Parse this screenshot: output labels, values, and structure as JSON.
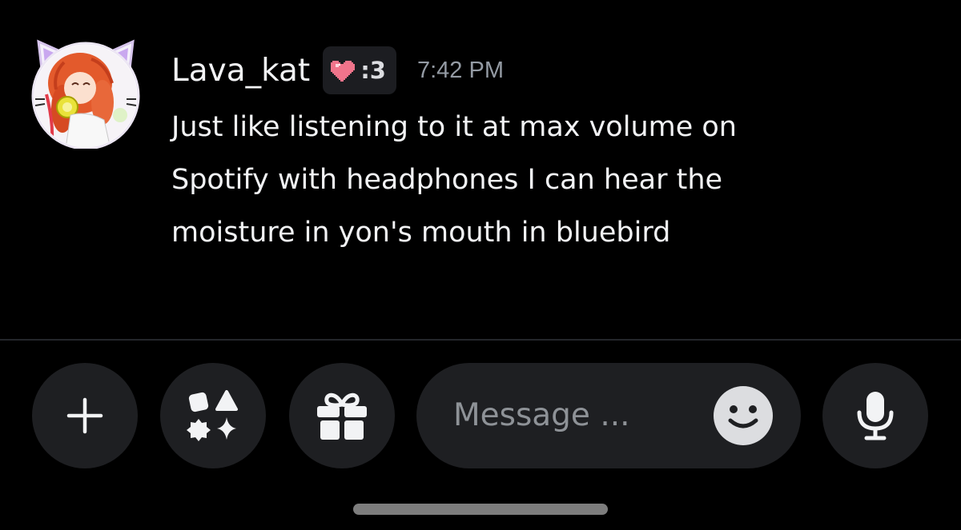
{
  "message": {
    "author": {
      "username": "Lava_kat",
      "clan_tag": ":3",
      "clan_icon": "pixel-heart-icon",
      "avatar": "anime-cat-girl-avatar"
    },
    "timestamp": "7:42 PM",
    "lines": [
      "Just like listening to it at max volume on",
      "Spotify with headphones I can hear the",
      "moisture in yon's mouth in bluebird"
    ]
  },
  "composer": {
    "buttons": {
      "add": "plus-icon",
      "apps": "apps-icon",
      "gift": "gift-icon",
      "emoji": "emoji-smile-icon",
      "voice": "microphone-icon"
    },
    "placeholder": "Message ..."
  },
  "colors": {
    "background": "#000000",
    "text": "#f2f3f5",
    "muted": "#949ba4",
    "button_bg": "#1e1f22",
    "clan_heart": "#f1748b"
  }
}
